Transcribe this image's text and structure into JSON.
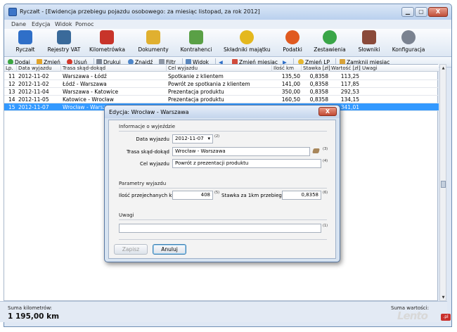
{
  "window": {
    "title": "Ryczałt - [Ewidencja przebiegu pojazdu osobowego: za miesiąc listopad, za rok 2012]",
    "minimize": "▁",
    "maximize": "▢",
    "close": "X"
  },
  "menu": [
    "Dane",
    "Edycja",
    "Widok",
    "Pomoc"
  ],
  "ribbon": [
    {
      "label": "Ryczałt",
      "icon": "book-icon",
      "color": "#2f6fc8"
    },
    {
      "label": "Rejestry VAT",
      "icon": "ledger-icon",
      "color": "#3a6a9a"
    },
    {
      "label": "Kilometrówka",
      "icon": "car-icon",
      "color": "#c8342a"
    },
    {
      "label": "Dokumenty",
      "icon": "documents-icon",
      "color": "#e0b030"
    },
    {
      "label": "Kontrahenci",
      "icon": "people-icon",
      "color": "#5aa046"
    },
    {
      "label": "Składniki majątku",
      "icon": "coin-icon",
      "color": "#e4b81e"
    },
    {
      "label": "Podatki",
      "icon": "tax-icon",
      "color": "#e05a20"
    },
    {
      "label": "Zestawienia",
      "icon": "pie-chart-icon",
      "color": "#3aa648"
    },
    {
      "label": "Słowniki",
      "icon": "dictionary-icon",
      "color": "#8a4a3a"
    },
    {
      "label": "Konfiguracja",
      "icon": "gear-icon",
      "color": "#7a8290"
    }
  ],
  "toolbar": {
    "add": "Dodaj",
    "edit": "Zmień",
    "delete": "Usuń",
    "print": "Drukuj",
    "find": "Znajdź",
    "filter": "Filtr",
    "view": "Widok",
    "prev_arrow": "◀",
    "change_month": "Zmień miesiąc",
    "next_arrow": "▶",
    "change_lp": "Zmień LP",
    "close_month": "Zamknij miesiąc"
  },
  "table": {
    "columns": [
      "Lp.",
      "Data wyjazdu",
      "Trasa skąd-dokąd",
      "Cel wyjazdu",
      "Ilość km",
      "Stawka [zł]",
      "Wartość [zł]",
      "Uwagi"
    ],
    "rows": [
      {
        "lp": "11",
        "date": "2012-11-02",
        "route": "Warszawa - Łódź",
        "purpose": "Spotkanie z klientem",
        "km": "135,50",
        "rate": "0,8358",
        "value": "113,25",
        "notes": ""
      },
      {
        "lp": "12",
        "date": "2012-11-02",
        "route": "Łódź - Warszawa",
        "purpose": "Powrót ze spotkania z klientem",
        "km": "141,00",
        "rate": "0,8358",
        "value": "117,85",
        "notes": ""
      },
      {
        "lp": "13",
        "date": "2012-11-04",
        "route": "Warszawa - Katowice",
        "purpose": "Prezentacja produktu",
        "km": "350,00",
        "rate": "0,8358",
        "value": "292,53",
        "notes": ""
      },
      {
        "lp": "14",
        "date": "2012-11-05",
        "route": "Katowice - Wrocław",
        "purpose": "Prezentacja produktu",
        "km": "160,50",
        "rate": "0,8358",
        "value": "134,15",
        "notes": ""
      },
      {
        "lp": "15",
        "date": "2012-11-07",
        "route": "Wrocław - Warszawa",
        "purpose": "",
        "km": "",
        "rate": "",
        "value": "341,01",
        "notes": ""
      }
    ]
  },
  "status": {
    "km_label": "Suma kilometrów:",
    "km_value": "1 195,00  km",
    "value_label": "Suma wartości:"
  },
  "dialog": {
    "title": "Edycja: Wrocław - Warszawa",
    "close": "X",
    "trip_section": "Informacje o wyjeździe",
    "date_label": "Data wyjazdu",
    "date_value": "2012-11-07",
    "date_dropdown": "▾",
    "route_label": "Trasa skąd-dokąd",
    "route_value": "Wrocław - Warszawa",
    "purpose_label": "Cel wyjazdu",
    "purpose_value": "Powrót z prezentacji produktu",
    "params_section": "Parametry wyjazdu",
    "km_label": "Ilość przejechanych km",
    "km_value": "408",
    "rate_label": "Stawka za 1km przebiegu",
    "rate_value": "0,8358",
    "notes_section": "Uwagi",
    "notes_value": "",
    "hints": [
      "(1)",
      "(2)",
      "(3)",
      "(4)",
      "(5)",
      "(6)"
    ],
    "save_button": "Zapisz",
    "cancel_button": "Anuluj"
  },
  "watermark": {
    "text": "Lento",
    "suffix": ".pl"
  }
}
